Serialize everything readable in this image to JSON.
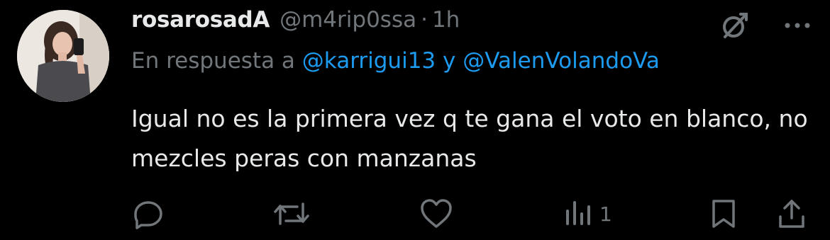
{
  "tweet": {
    "display_name": "rosarosadA",
    "handle": "@m4rip0ssa",
    "separator": "·",
    "time": "1h",
    "reply_prefix": "En respuesta a",
    "reply_user_1": "@karrigui13",
    "reply_joiner": "y",
    "reply_user_2": "@ValenVolandoVa",
    "text": "Igual no es la primera vez q te gana el voto en blanco, no mezcles peras con manzanas",
    "views": "1"
  },
  "colors": {
    "background": "#000000",
    "primary_text": "#e7e9ea",
    "secondary_text": "#71767b",
    "accent": "#1d9bf0"
  },
  "icons": {
    "top_right": [
      "grok-icon",
      "more-icon"
    ],
    "actions": [
      "reply-icon",
      "retweet-icon",
      "like-icon",
      "views-icon",
      "bookmark-icon",
      "share-icon"
    ]
  }
}
